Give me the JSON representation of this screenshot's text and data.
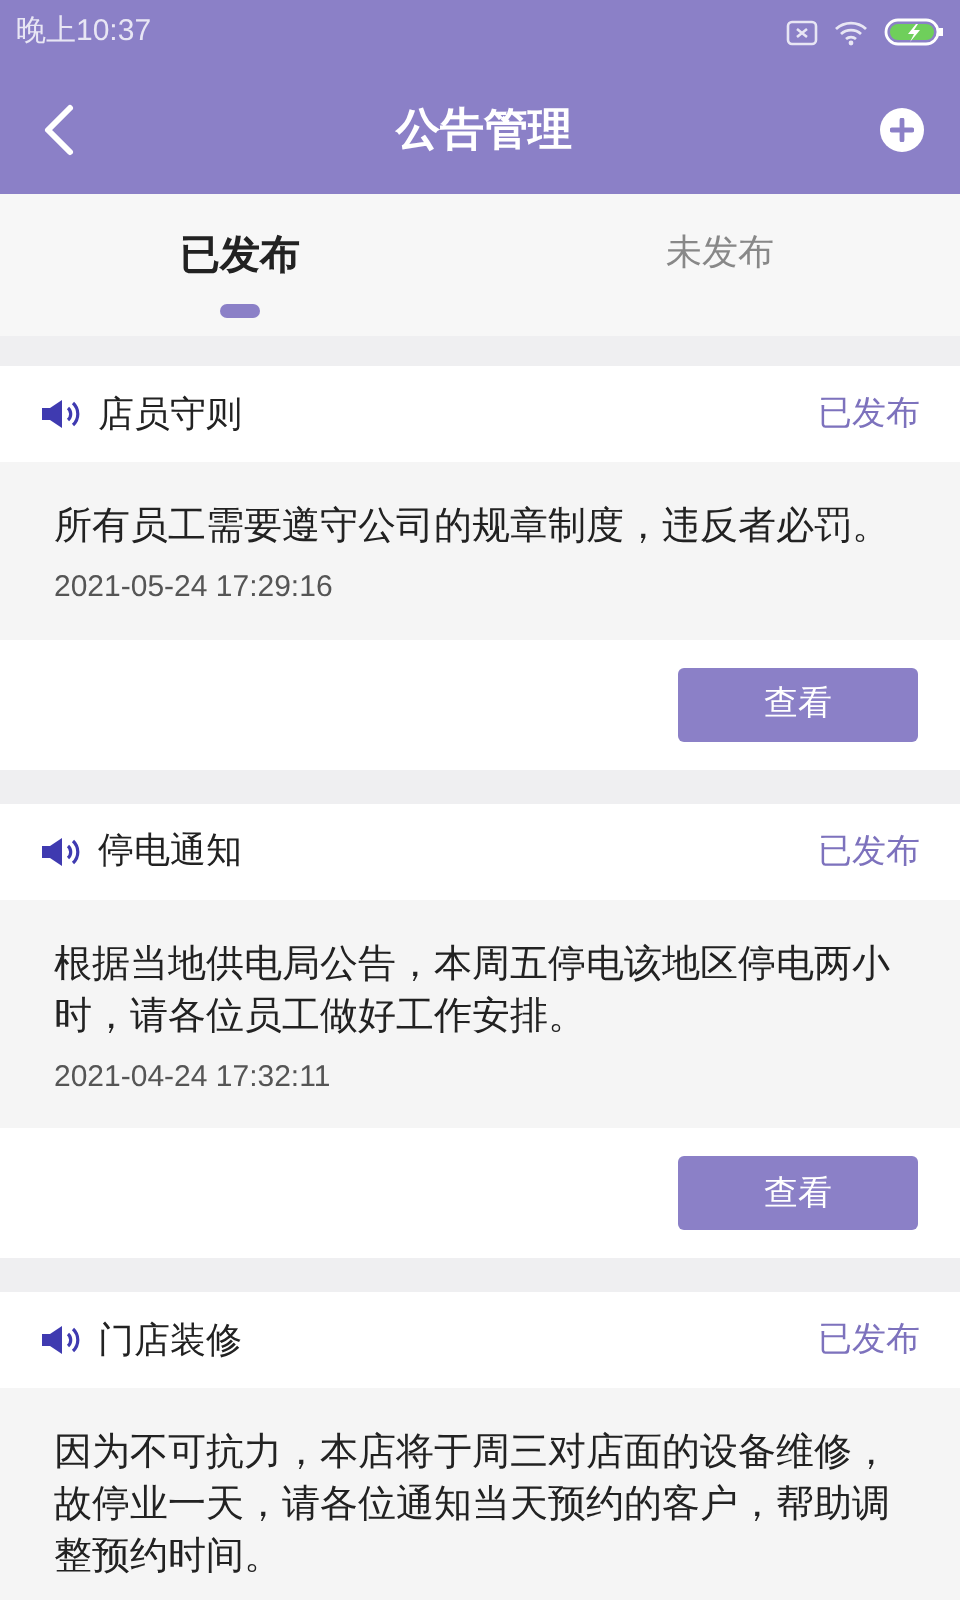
{
  "status_bar": {
    "time": "晚上10:37"
  },
  "header": {
    "title": "公告管理"
  },
  "tabs": [
    {
      "label": "已发布",
      "selected": true
    },
    {
      "label": "未发布",
      "selected": false
    }
  ],
  "notices": [
    {
      "title": "店员守则",
      "status": "已发布",
      "content": "所有员工需要遵守公司的规章制度，违反者必罚。",
      "time": "2021-05-24 17:29:16",
      "button": "查看"
    },
    {
      "title": "停电通知",
      "status": "已发布",
      "content": "根据当地供电局公告，本周五停电该地区停电两小时，请各位员工做好工作安排。",
      "time": "2021-04-24 17:32:11",
      "button": "查看"
    },
    {
      "title": "门店装修",
      "status": "已发布",
      "content": "因为不可抗力，本店将于周三对店面的设备维修，故停业一天，请各位通知当天预约的客户，帮助调整预约时间。"
    }
  ]
}
